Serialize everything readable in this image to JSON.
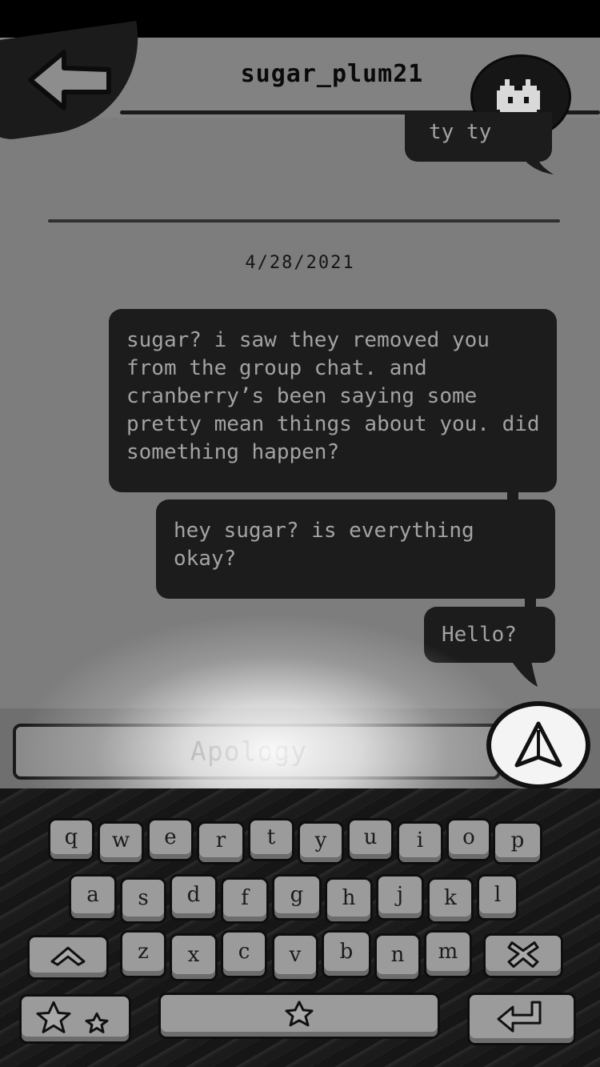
{
  "header": {
    "contact_name": "sugar_plum21"
  },
  "conversation": {
    "date_separator": "4/28/2021",
    "messages": [
      {
        "text": "ty ty"
      },
      {
        "text": "sugar? i saw they removed you from the group chat. and cranberry’s been saying some pretty mean things about you. did something happen?"
      },
      {
        "text": "hey sugar? is everything okay?"
      },
      {
        "text": "Hello?"
      }
    ]
  },
  "composer": {
    "selected_choice": "Apology"
  },
  "keyboard": {
    "row1": [
      "q",
      "w",
      "e",
      "r",
      "t",
      "y",
      "u",
      "i",
      "o",
      "p"
    ],
    "row2": [
      "a",
      "s",
      "d",
      "f",
      "g",
      "h",
      "j",
      "k",
      "l"
    ],
    "row3": [
      "z",
      "x",
      "c",
      "v",
      "b",
      "n",
      "m"
    ]
  },
  "colors": {
    "bubble": "#1c1c1c",
    "bubble_text": "#a3a3a3",
    "background": "#7d7d7d",
    "key": "#9b9b9b"
  },
  "icons": [
    "back-arrow-icon",
    "avatar-icon",
    "send-icon",
    "shift-icon",
    "delete-icon",
    "emoji-star-icon",
    "star-icon",
    "return-icon"
  ]
}
